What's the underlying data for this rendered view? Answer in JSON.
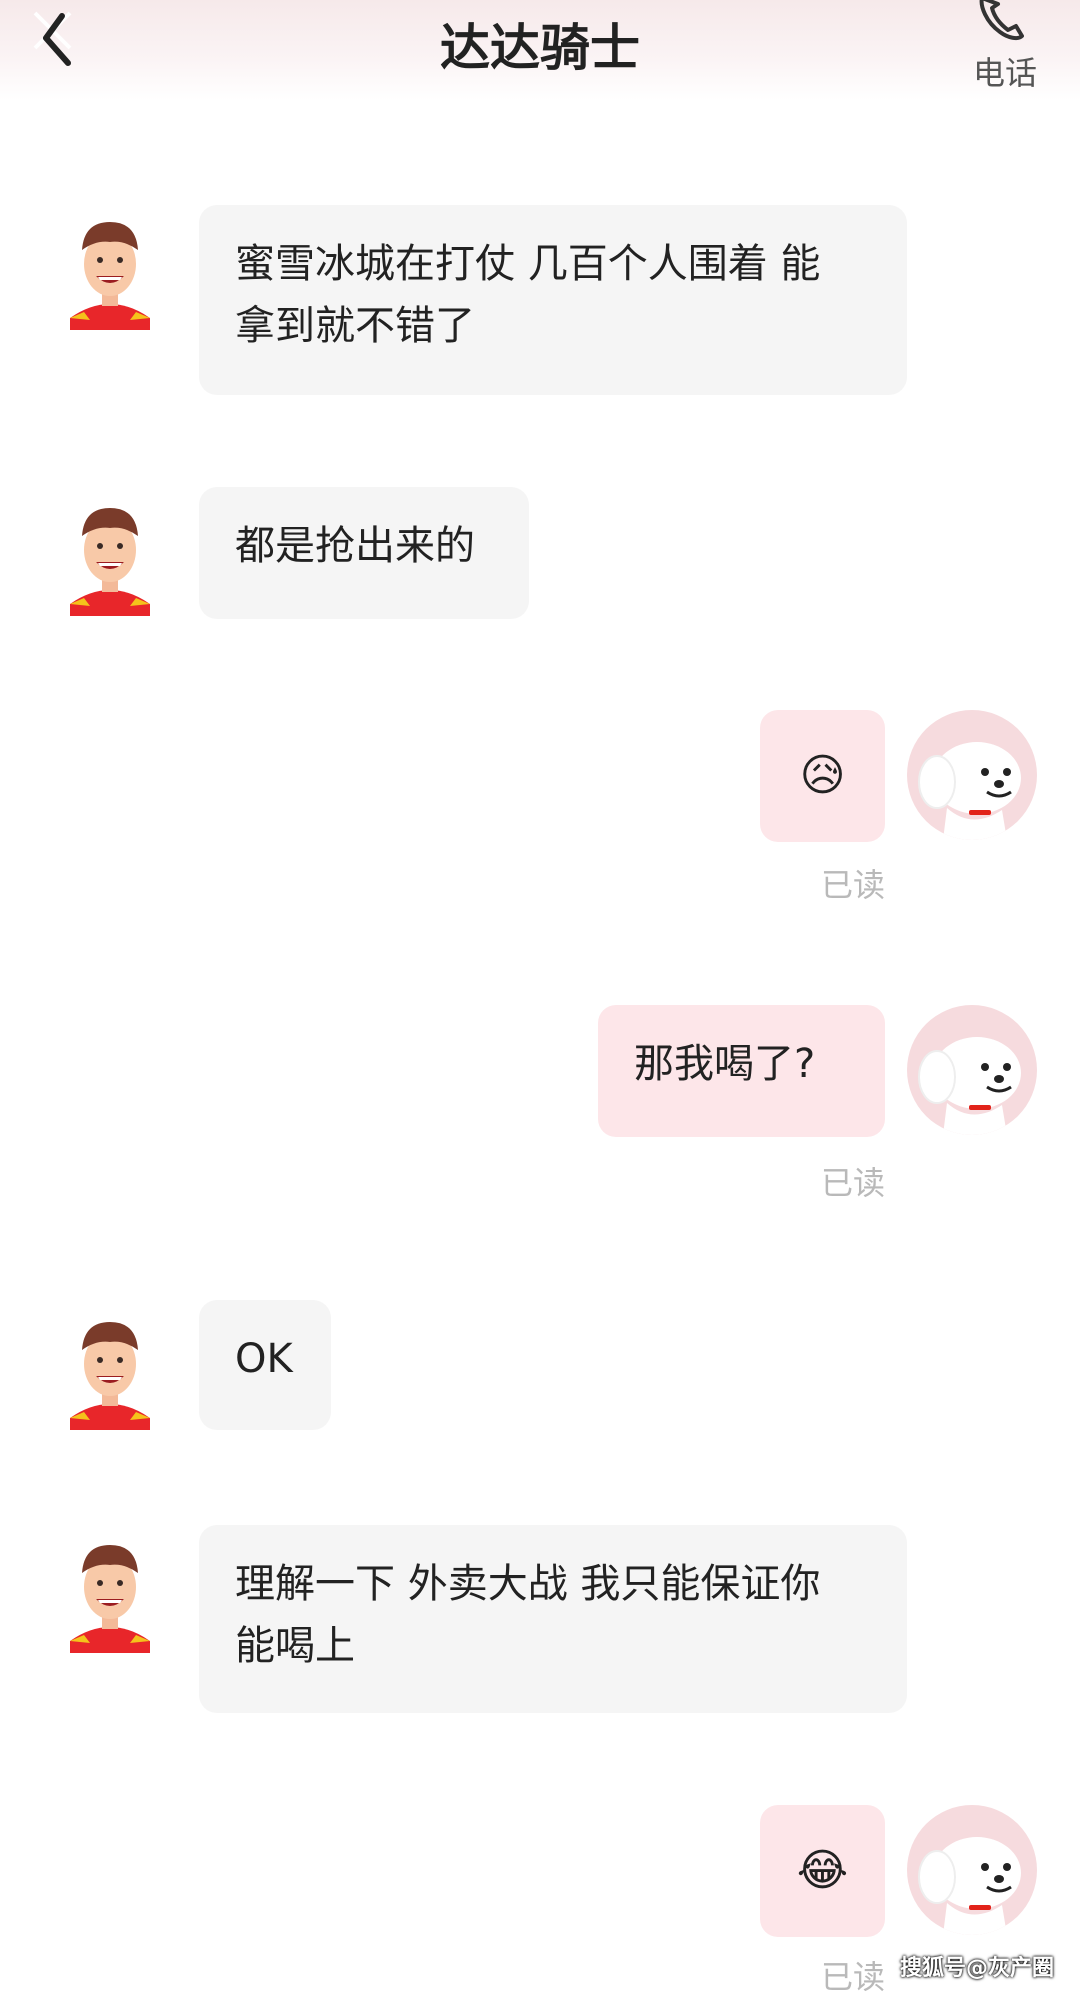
{
  "header": {
    "title": "达达骑士",
    "call_label": "电话",
    "back_icon": "chevron-left-icon",
    "call_icon": "phone-icon"
  },
  "messages": [
    {
      "side": "in",
      "text_lines": [
        "蜜雪冰城在打仗 几百个人围着 能",
        "拿到就不错了"
      ]
    },
    {
      "side": "in",
      "text_lines": [
        "都是抢出来的"
      ]
    },
    {
      "side": "out",
      "emoji": "😥",
      "emoji_name": "sad-sweat-emoji",
      "status": "已读"
    },
    {
      "side": "out",
      "text_lines": [
        "那我喝了?"
      ],
      "status": "已读"
    },
    {
      "side": "in",
      "text_lines": [
        "OK"
      ]
    },
    {
      "side": "in",
      "text_lines": [
        "理解一下 外卖大战 我只能保证你",
        "能喝上"
      ]
    },
    {
      "side": "out",
      "emoji": "😂",
      "emoji_name": "tears-of-joy-emoji",
      "status": "已读"
    }
  ],
  "watermark": "搜狐号@灰产圈",
  "colors": {
    "incoming_bubble": "#f5f5f5",
    "outgoing_bubble": "#fde6e9",
    "read_status": "#b9b9b9",
    "header_tint": "#f6e9ea"
  }
}
